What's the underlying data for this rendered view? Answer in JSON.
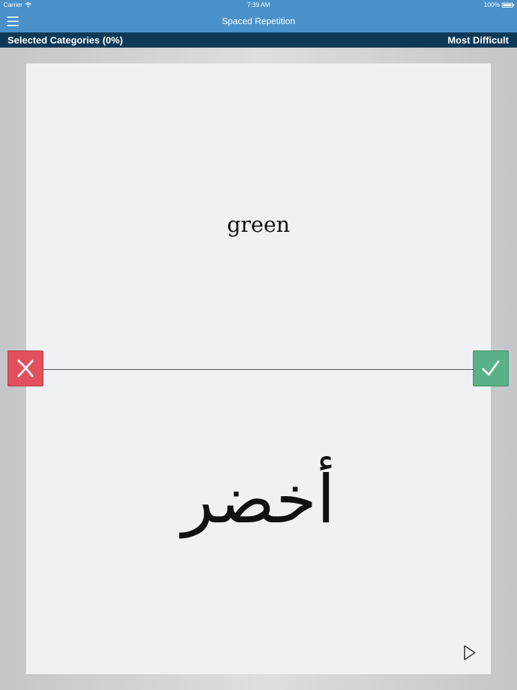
{
  "status_bar": {
    "carrier": "Carrier",
    "time": "7:39 AM",
    "battery": "100%",
    "battery_level": 1.0
  },
  "nav": {
    "title": "Spaced Repetition",
    "menu_icon": "hamburger-menu-icon"
  },
  "sub_bar": {
    "left_label": "Selected Categories (0%)",
    "right_label": "Most Difficult"
  },
  "card": {
    "front": "green",
    "back": "أخضر"
  },
  "controls": {
    "wrong_icon": "x-mark-icon",
    "right_icon": "checkmark-icon",
    "play_icon": "play-icon"
  },
  "colors": {
    "bar_blue": "#4a91c9",
    "sub_bar_navy": "#0e3a58",
    "wrong_red": "#e3505d",
    "right_green": "#58b287",
    "card_bg": "#f0f1f3"
  }
}
